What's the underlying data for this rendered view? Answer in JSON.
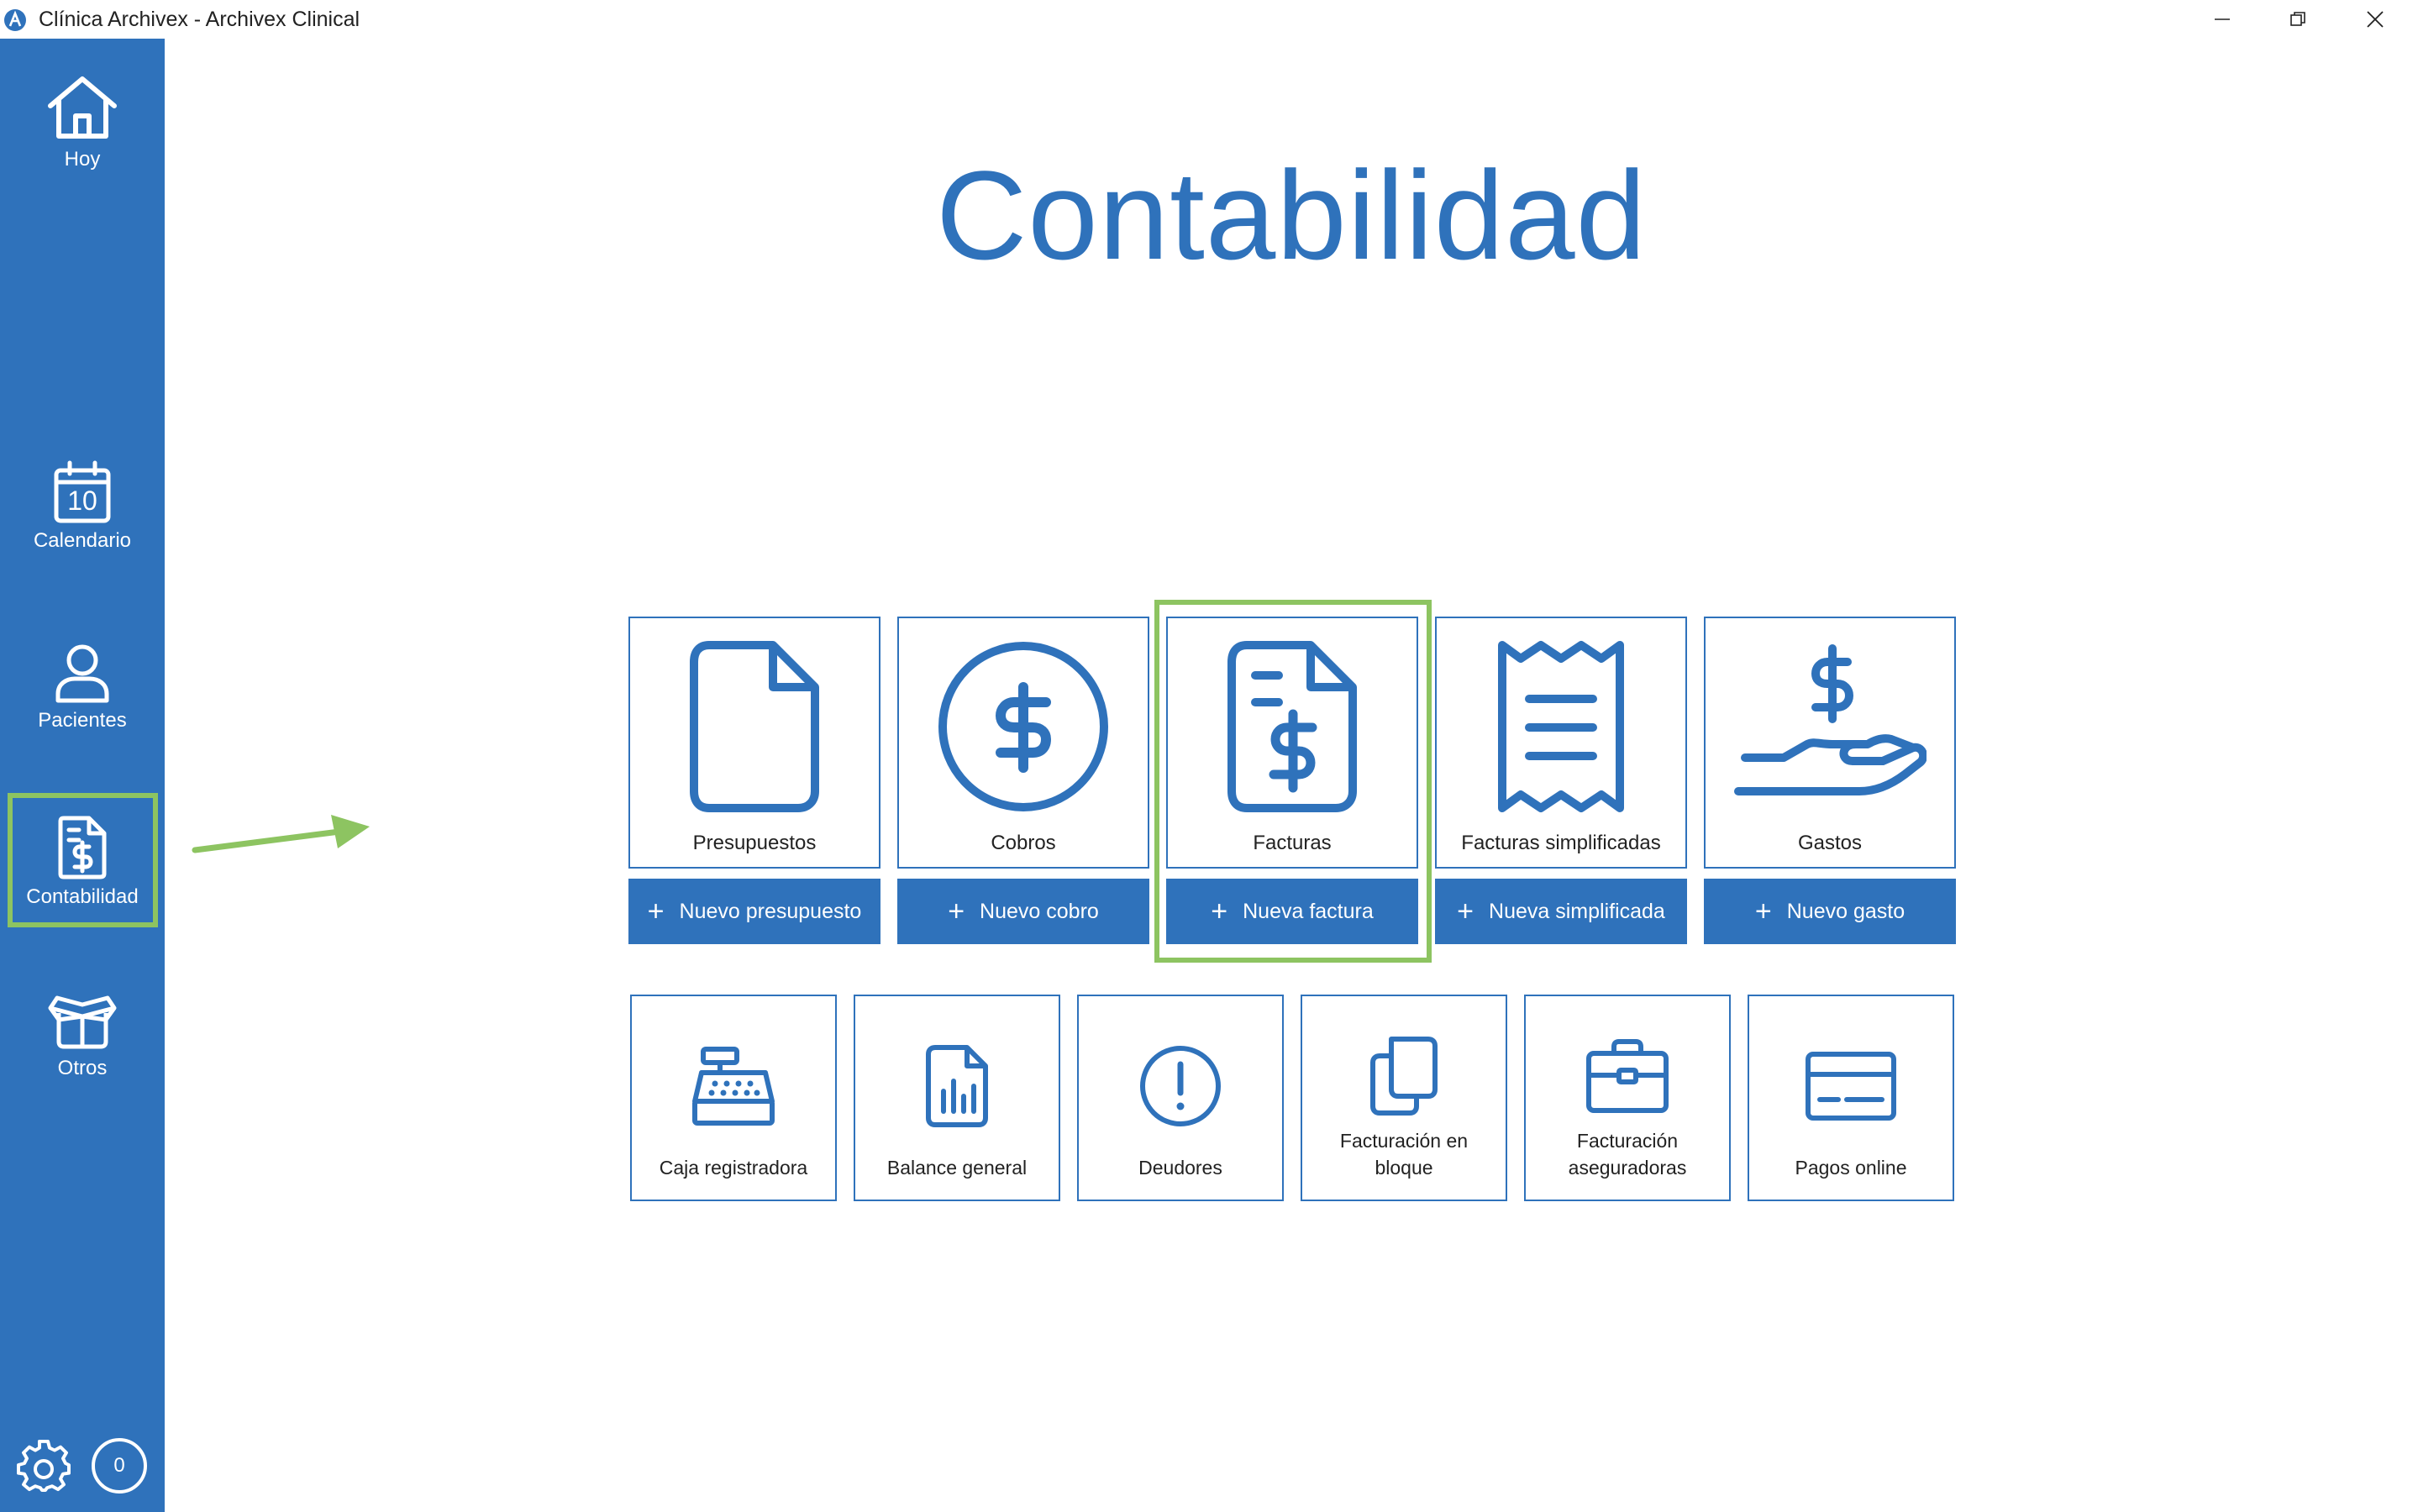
{
  "window": {
    "title": "Clínica Archivex - Archivex Clinical"
  },
  "sidebar": {
    "items": [
      {
        "label": "Hoy",
        "icon": "home-icon"
      },
      {
        "label": "Calendario",
        "icon": "calendar-icon",
        "day": "10"
      },
      {
        "label": "Pacientes",
        "icon": "user-icon"
      },
      {
        "label": "Contabilidad",
        "icon": "invoice-icon",
        "active": true
      },
      {
        "label": "Otros",
        "icon": "box-icon"
      }
    ],
    "notification_count": "0"
  },
  "page": {
    "title": "Contabilidad"
  },
  "main_tiles": [
    {
      "label": "Presupuestos",
      "icon": "document-icon",
      "action": "Nuevo presupuesto"
    },
    {
      "label": "Cobros",
      "icon": "dollar-circle-icon",
      "action": "Nuevo cobro"
    },
    {
      "label": "Facturas",
      "icon": "invoice-icon",
      "action": "Nueva factura",
      "highlighted": true
    },
    {
      "label": "Facturas simplificadas",
      "icon": "receipt-icon",
      "action": "Nueva simplificada"
    },
    {
      "label": "Gastos",
      "icon": "hand-dollar-icon",
      "action": "Nuevo gasto"
    }
  ],
  "secondary_tiles": [
    {
      "label": "Caja registradora",
      "icon": "cash-register-icon"
    },
    {
      "label": "Balance general",
      "icon": "report-chart-icon"
    },
    {
      "label": "Deudores",
      "icon": "alert-circle-icon"
    },
    {
      "label": "Facturación en bloque",
      "icon": "copy-icon"
    },
    {
      "label": "Facturación aseguradoras",
      "icon": "briefcase-icon"
    },
    {
      "label": "Pagos online",
      "icon": "credit-card-icon"
    }
  ],
  "colors": {
    "brand": "#2f72bb",
    "highlight": "#8dc461"
  }
}
